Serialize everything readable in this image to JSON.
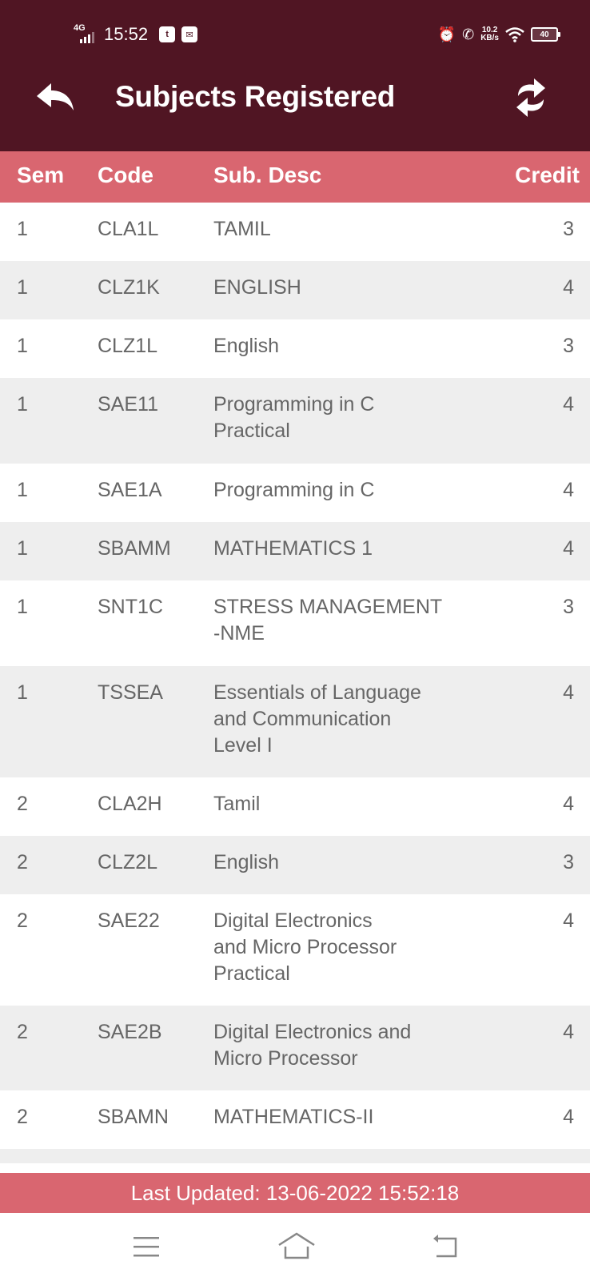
{
  "status_bar": {
    "network": "4G",
    "time": "15:52",
    "notification_icons": [
      "t-app-icon",
      "mail-box-icon"
    ],
    "right_icons": [
      "alarm-icon",
      "wifi-calling-icon"
    ],
    "net_speed_value": "10.2",
    "net_speed_unit": "KB/s",
    "battery": "40"
  },
  "header": {
    "title": "Subjects Registered",
    "back_icon": "reply-arrow-icon",
    "refresh_icon": "refresh-icon"
  },
  "table": {
    "columns": {
      "sem": "Sem",
      "code": "Code",
      "desc": "Sub. Desc",
      "credit": "Credit"
    },
    "rows": [
      {
        "sem": "1",
        "code": "CLA1L",
        "desc": "TAMIL",
        "credit": "3"
      },
      {
        "sem": "1",
        "code": "CLZ1K",
        "desc": "ENGLISH",
        "credit": "4"
      },
      {
        "sem": "1",
        "code": "CLZ1L",
        "desc": "English",
        "credit": "3"
      },
      {
        "sem": "1",
        "code": "SAE11",
        "desc": "Programming in C\nPractical",
        "credit": "4"
      },
      {
        "sem": "1",
        "code": "SAE1A",
        "desc": "Programming in C",
        "credit": "4"
      },
      {
        "sem": "1",
        "code": "SBAMM",
        "desc": "MATHEMATICS 1",
        "credit": "4"
      },
      {
        "sem": "1",
        "code": "SNT1C",
        "desc": "STRESS MANAGEMENT\n-NME",
        "credit": "3"
      },
      {
        "sem": "1",
        "code": "TSSEA",
        "desc": "Essentials of Language\nand  Communication\nLevel I",
        "credit": "4"
      },
      {
        "sem": "2",
        "code": "CLA2H",
        "desc": "Tamil",
        "credit": "4"
      },
      {
        "sem": "2",
        "code": "CLZ2L",
        "desc": "English",
        "credit": "3"
      },
      {
        "sem": "2",
        "code": "SAE22",
        "desc": "Digital Electronics\nand Micro Processor\nPractical",
        "credit": "4"
      },
      {
        "sem": "2",
        "code": "SAE2B",
        "desc": "Digital Electronics and\nMicro Processor",
        "credit": "4"
      },
      {
        "sem": "2",
        "code": "SBAMN",
        "desc": "MATHEMATICS-II",
        "credit": "4"
      },
      {
        "sem": "",
        "code": "",
        "desc": "",
        "credit": ""
      }
    ]
  },
  "footer": {
    "last_updated": "Last Updated: 13-06-2022 15:52:18"
  },
  "nav_bar": {
    "items": [
      "menu-icon",
      "home-icon",
      "back-icon"
    ]
  },
  "colors": {
    "app_bar": "#501523",
    "accent": "#d96670",
    "row_alt": "#eeeeee",
    "text": "#666666"
  }
}
